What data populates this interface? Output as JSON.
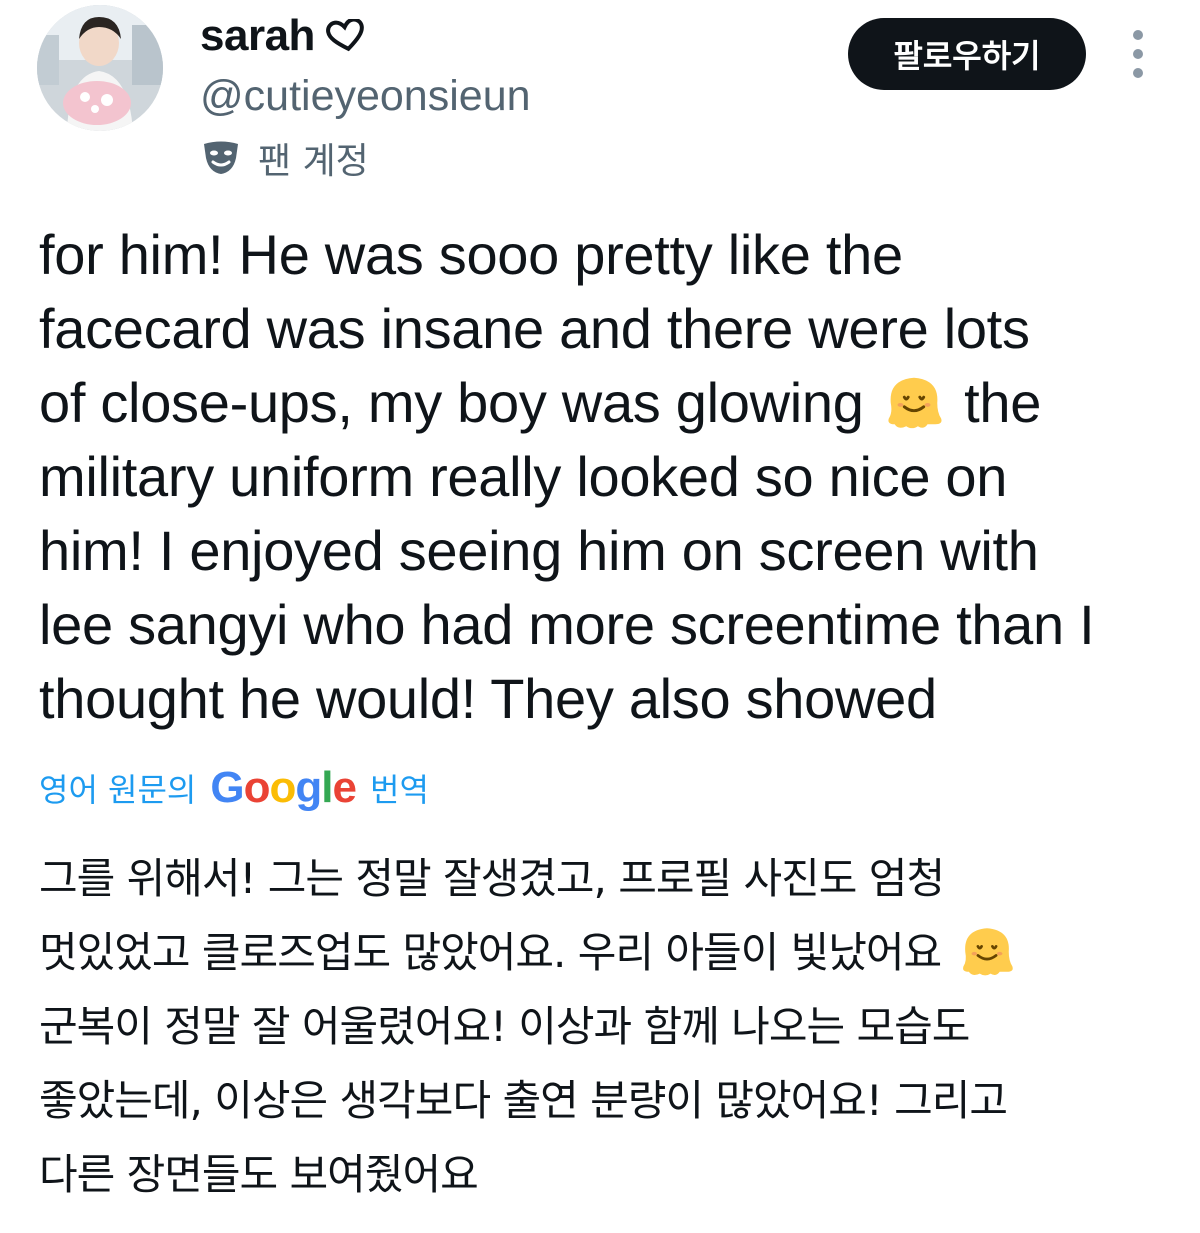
{
  "user": {
    "display_name": "sarah",
    "name_icon": "heart-outline-icon",
    "handle": "@cutieyeonsieun",
    "badge_icon": "theater-mask-icon",
    "badge_label": "팬 계정",
    "avatar": "profile-photo"
  },
  "actions": {
    "follow_label": "팔로우하기",
    "more_icon": "more-vertical-icon"
  },
  "tweet": {
    "lines": [
      "for him! He was sooo pretty like the",
      "facecard was insane and there were lots",
      "of close-ups, my boy was glowing",
      "the",
      "military uniform really looked so nice on",
      "him! I enjoyed seeing him on screen with",
      "lee sangyi who had more screentime than I",
      "thought he would! They also showed"
    ],
    "emoji": "melting-face-emoji"
  },
  "translation": {
    "prefix": "영어 원문의",
    "provider": "Google",
    "suffix": "번역",
    "lines": [
      "그를 위해서! 그는 정말 잘생겼고, 프로필 사진도 엄청",
      "멋있었고 클로즈업도 많았어요. 우리 아들이 빛났어요",
      "군복이 정말 잘 어울렸어요! 이상과 함께 나오는 모습도",
      "좋았는데, 이상은 생각보다 출연 분량이 많았어요! 그리고",
      "다른 장면들도 보여줬어요"
    ]
  },
  "colors": {
    "text": "#0f1419",
    "secondary": "#536471",
    "link": "#1d9bf0",
    "button_bg": "#0f1419"
  }
}
